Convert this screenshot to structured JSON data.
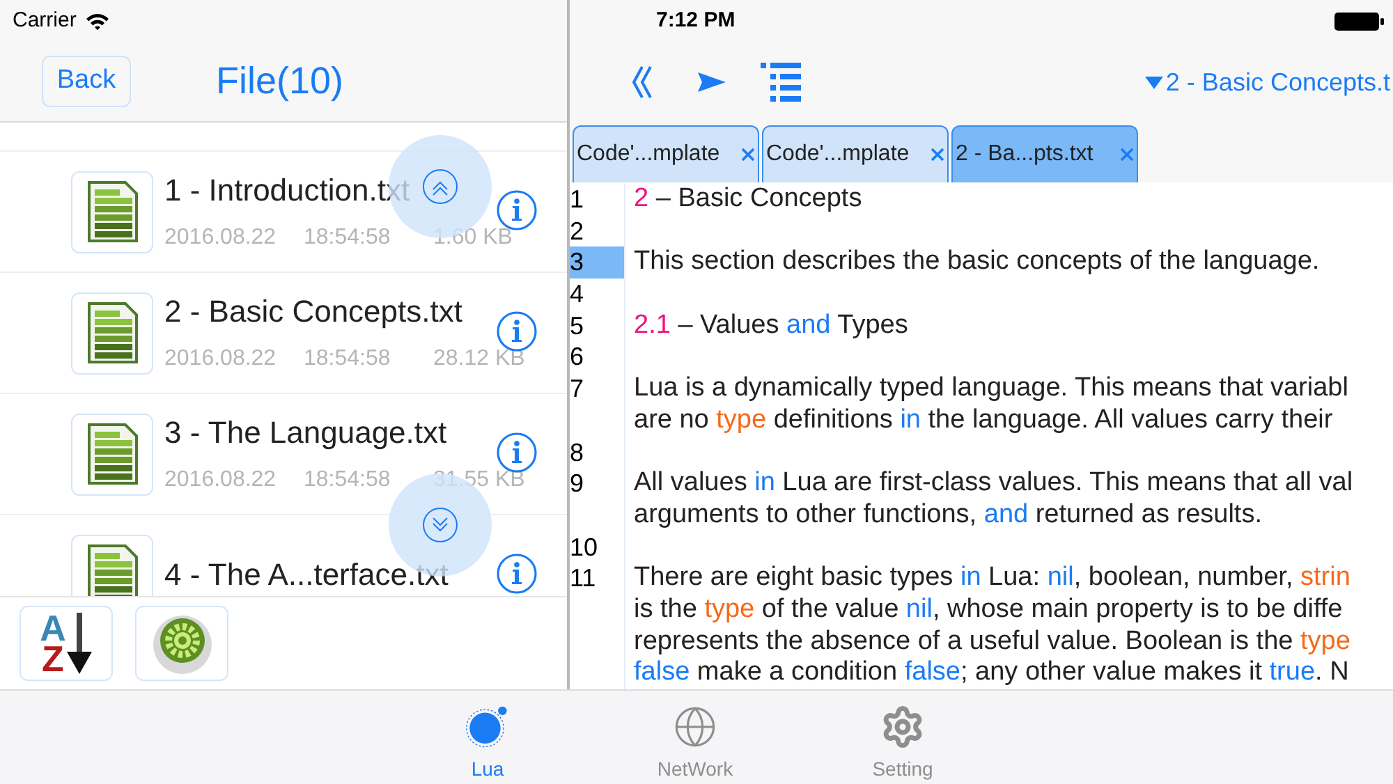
{
  "status_bar": {
    "carrier": "Carrier",
    "time": "7:12 PM"
  },
  "file_panel": {
    "back_button": "Back",
    "title": "File(10)",
    "files": [
      {
        "name": "1 - Introduction.txt",
        "date": "2016.08.22",
        "time": "18:54:58",
        "size": "1.60 KB"
      },
      {
        "name": "2 - Basic Concepts.txt",
        "date": "2016.08.22",
        "time": "18:54:58",
        "size": "28.12 KB"
      },
      {
        "name": "3 - The Language.txt",
        "date": "2016.08.22",
        "time": "18:54:58",
        "size": "31.55 KB"
      },
      {
        "name": "4 - The A...terface.txt"
      }
    ],
    "sort_button": {
      "letters": [
        "A",
        "Z"
      ]
    }
  },
  "editor": {
    "document_menu": "2 - Basic Concepts.t",
    "tabs": [
      {
        "label": "Code'...mplate",
        "selected": false
      },
      {
        "label": "Code'...mplate",
        "selected": false
      },
      {
        "label": "2 - Ba...pts.txt",
        "selected": true
      }
    ],
    "lines": [
      {
        "number": "1",
        "selected": false,
        "rows": [
          {
            "spans": [
              {
                "kind": "number",
                "text": "2"
              },
              {
                "kind": "plain",
                "text": " – Basic Concepts"
              }
            ]
          }
        ]
      },
      {
        "number": "2",
        "selected": false
      },
      {
        "number": "3",
        "selected": true,
        "rows": [
          {
            "spans": [
              {
                "kind": "plain",
                "text": "This section describes the basic concepts of the language."
              }
            ]
          }
        ]
      },
      {
        "number": "4",
        "selected": false
      },
      {
        "number": "5",
        "selected": false,
        "rows": [
          {
            "spans": [
              {
                "kind": "number",
                "text": "2.1"
              },
              {
                "kind": "plain",
                "text": " – Values "
              },
              {
                "kind": "keyword",
                "text": "and"
              },
              {
                "kind": "plain",
                "text": " Types"
              }
            ]
          }
        ]
      },
      {
        "number": "6",
        "selected": false
      },
      {
        "number": "7",
        "selected": false,
        "rows": [
          {
            "spans": [
              {
                "kind": "plain",
                "text": "Lua is a dynamically typed language. This means that variabl"
              }
            ]
          },
          {
            "spans": [
              {
                "kind": "plain",
                "text": "are no "
              },
              {
                "kind": "type",
                "text": "type"
              },
              {
                "kind": "plain",
                "text": " definitions "
              },
              {
                "kind": "keyword",
                "text": "in"
              },
              {
                "kind": "plain",
                "text": " the language. All values carry their"
              }
            ]
          }
        ]
      },
      {
        "number": "8",
        "selected": false
      },
      {
        "number": "9",
        "selected": false,
        "rows": [
          {
            "spans": [
              {
                "kind": "plain",
                "text": "All values "
              },
              {
                "kind": "keyword",
                "text": "in"
              },
              {
                "kind": "plain",
                "text": " Lua are first-class values. This means that all val"
              }
            ]
          },
          {
            "spans": [
              {
                "kind": "plain",
                "text": "arguments to other functions, "
              },
              {
                "kind": "keyword",
                "text": "and"
              },
              {
                "kind": "plain",
                "text": " returned as results."
              }
            ]
          }
        ]
      },
      {
        "number": "10",
        "selected": false
      },
      {
        "number": "11",
        "selected": false,
        "rows": [
          {
            "spans": [
              {
                "kind": "plain",
                "text": "There are eight basic types "
              },
              {
                "kind": "keyword",
                "text": "in"
              },
              {
                "kind": "plain",
                "text": " Lua: "
              },
              {
                "kind": "keyword",
                "text": "nil"
              },
              {
                "kind": "plain",
                "text": ", boolean, number, "
              },
              {
                "kind": "type",
                "text": "strin"
              }
            ]
          },
          {
            "spans": [
              {
                "kind": "plain",
                "text": "is the "
              },
              {
                "kind": "type",
                "text": "type"
              },
              {
                "kind": "plain",
                "text": " of the value "
              },
              {
                "kind": "keyword",
                "text": "nil"
              },
              {
                "kind": "plain",
                "text": ", whose main property is to be diffe"
              }
            ]
          },
          {
            "spans": [
              {
                "kind": "plain",
                "text": "represents the absence of a useful value. Boolean is the "
              },
              {
                "kind": "type",
                "text": "type"
              }
            ]
          },
          {
            "spans": [
              {
                "kind": "keyword",
                "text": "false"
              },
              {
                "kind": "plain",
                "text": " make a condition "
              },
              {
                "kind": "keyword",
                "text": "false"
              },
              {
                "kind": "plain",
                "text": "; any other value makes it "
              },
              {
                "kind": "keyword",
                "text": "true"
              },
              {
                "kind": "plain",
                "text": ". N"
              }
            ]
          }
        ]
      }
    ]
  },
  "tab_bar": [
    {
      "kind": "lua",
      "label": "Lua",
      "selected": true
    },
    {
      "kind": "network",
      "label": "NetWork",
      "selected": false
    },
    {
      "kind": "setting",
      "label": "Setting",
      "selected": false
    }
  ]
}
